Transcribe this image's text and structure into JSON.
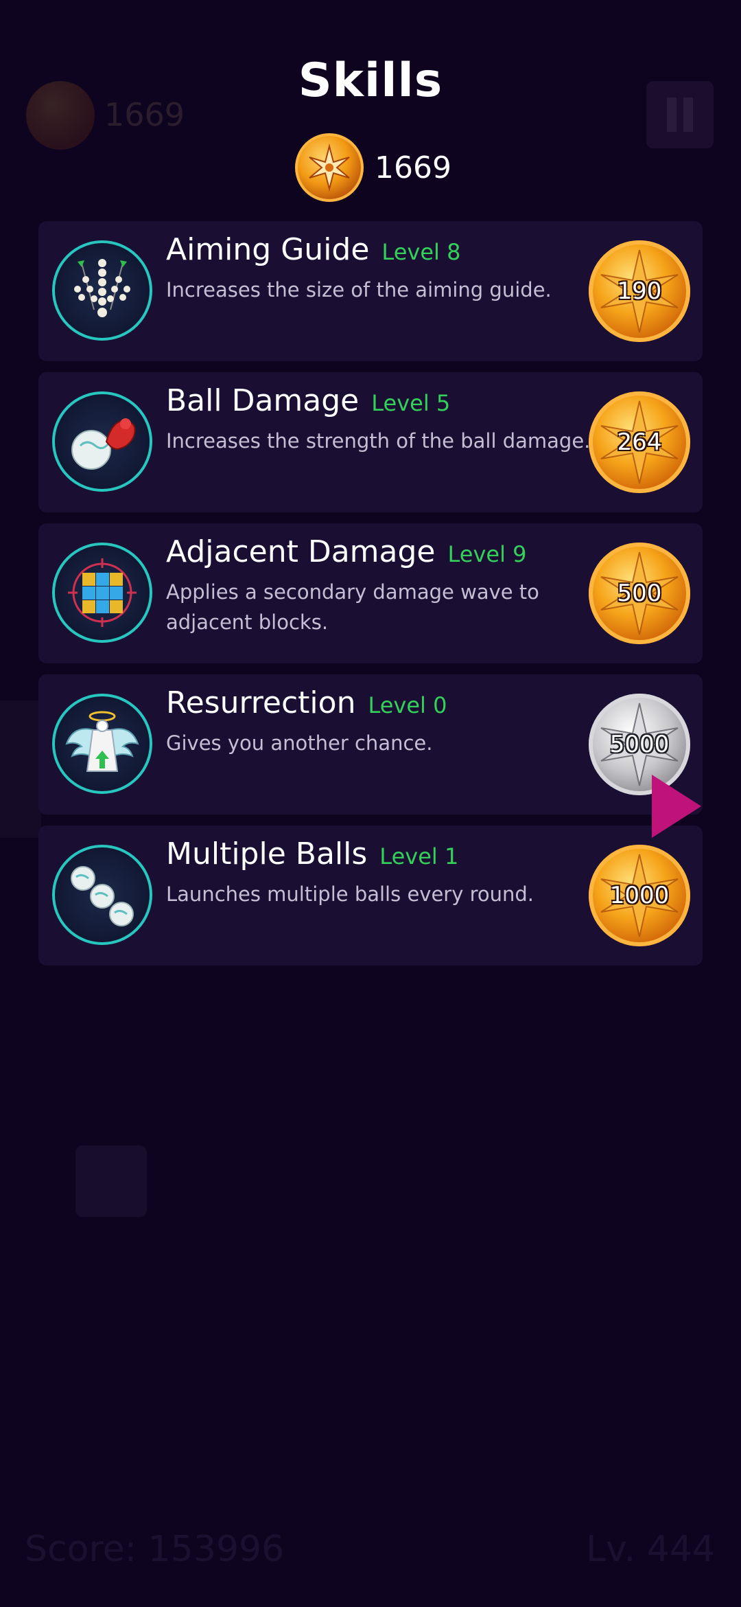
{
  "background": {
    "coin_count": "1669",
    "score": "Score: 153996",
    "level": "Lv. 444"
  },
  "title": "Skills",
  "balance": {
    "coin_count": "1669",
    "icon": "star-coin-icon"
  },
  "skills": [
    {
      "name": "Aiming Guide",
      "level": "Level 8",
      "description": "Increases the size of the aiming guide.",
      "price": "190",
      "coin": "gold",
      "icon": "aiming-guide-icon"
    },
    {
      "name": "Ball Damage",
      "level": "Level 5",
      "description": "Increases the strength of the ball damage.",
      "price": "264",
      "coin": "gold",
      "icon": "ball-damage-icon"
    },
    {
      "name": "Adjacent Damage",
      "level": "Level 9",
      "description": "Applies a secondary damage wave to adjacent blocks.",
      "price": "500",
      "coin": "gold",
      "icon": "adjacent-damage-icon"
    },
    {
      "name": "Resurrection",
      "level": "Level 0",
      "description": "Gives you another chance.",
      "price": "5000",
      "coin": "silver",
      "icon": "resurrection-icon"
    },
    {
      "name": "Multiple Balls",
      "level": "Level 1",
      "description": "Launches multiple balls every round.",
      "price": "1000",
      "coin": "gold",
      "icon": "multiple-balls-icon"
    }
  ],
  "colors": {
    "background": "#0e0420",
    "card": "#1a0f33",
    "level_text": "#33d15a",
    "icon_ring": "#27c7c0",
    "pointer": "#c0137a"
  }
}
